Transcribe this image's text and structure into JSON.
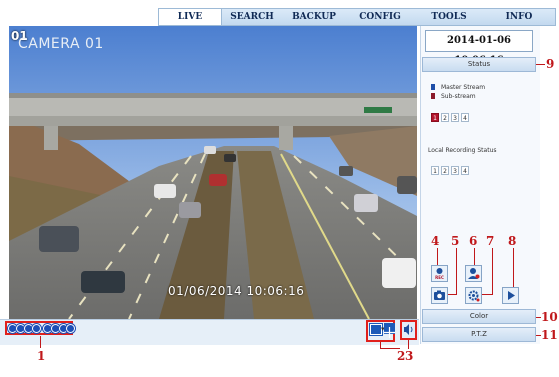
{
  "nav": {
    "tabs": [
      "LIVE",
      "SEARCH",
      "BACKUP",
      "CONFIG",
      "TOOLS",
      "INFO"
    ]
  },
  "camera": {
    "channel": "01",
    "name": "CAMERA 01",
    "overlay_timestamp": "01/06/2014  10:06:16"
  },
  "panel": {
    "datetime": "2014-01-06 10:06:16",
    "status_label": "Status",
    "legend_master": "Master Stream",
    "legend_sub": "Sub-stream",
    "channels": [
      "1",
      "2",
      "3",
      "4"
    ],
    "selected_channel": "1",
    "local_recording_label": "Local Recording Status",
    "rec_label": "REC",
    "color_label": "Color",
    "ptz_label": "P.T.Z"
  },
  "colors": {
    "master_stream": "#1f4fa8",
    "sub_stream": "#8b1a2b",
    "annotation_red": "#c0181b"
  },
  "annotations": [
    "1",
    "2",
    "3",
    "4",
    "5",
    "6",
    "7",
    "8",
    "9",
    "10",
    "11"
  ]
}
